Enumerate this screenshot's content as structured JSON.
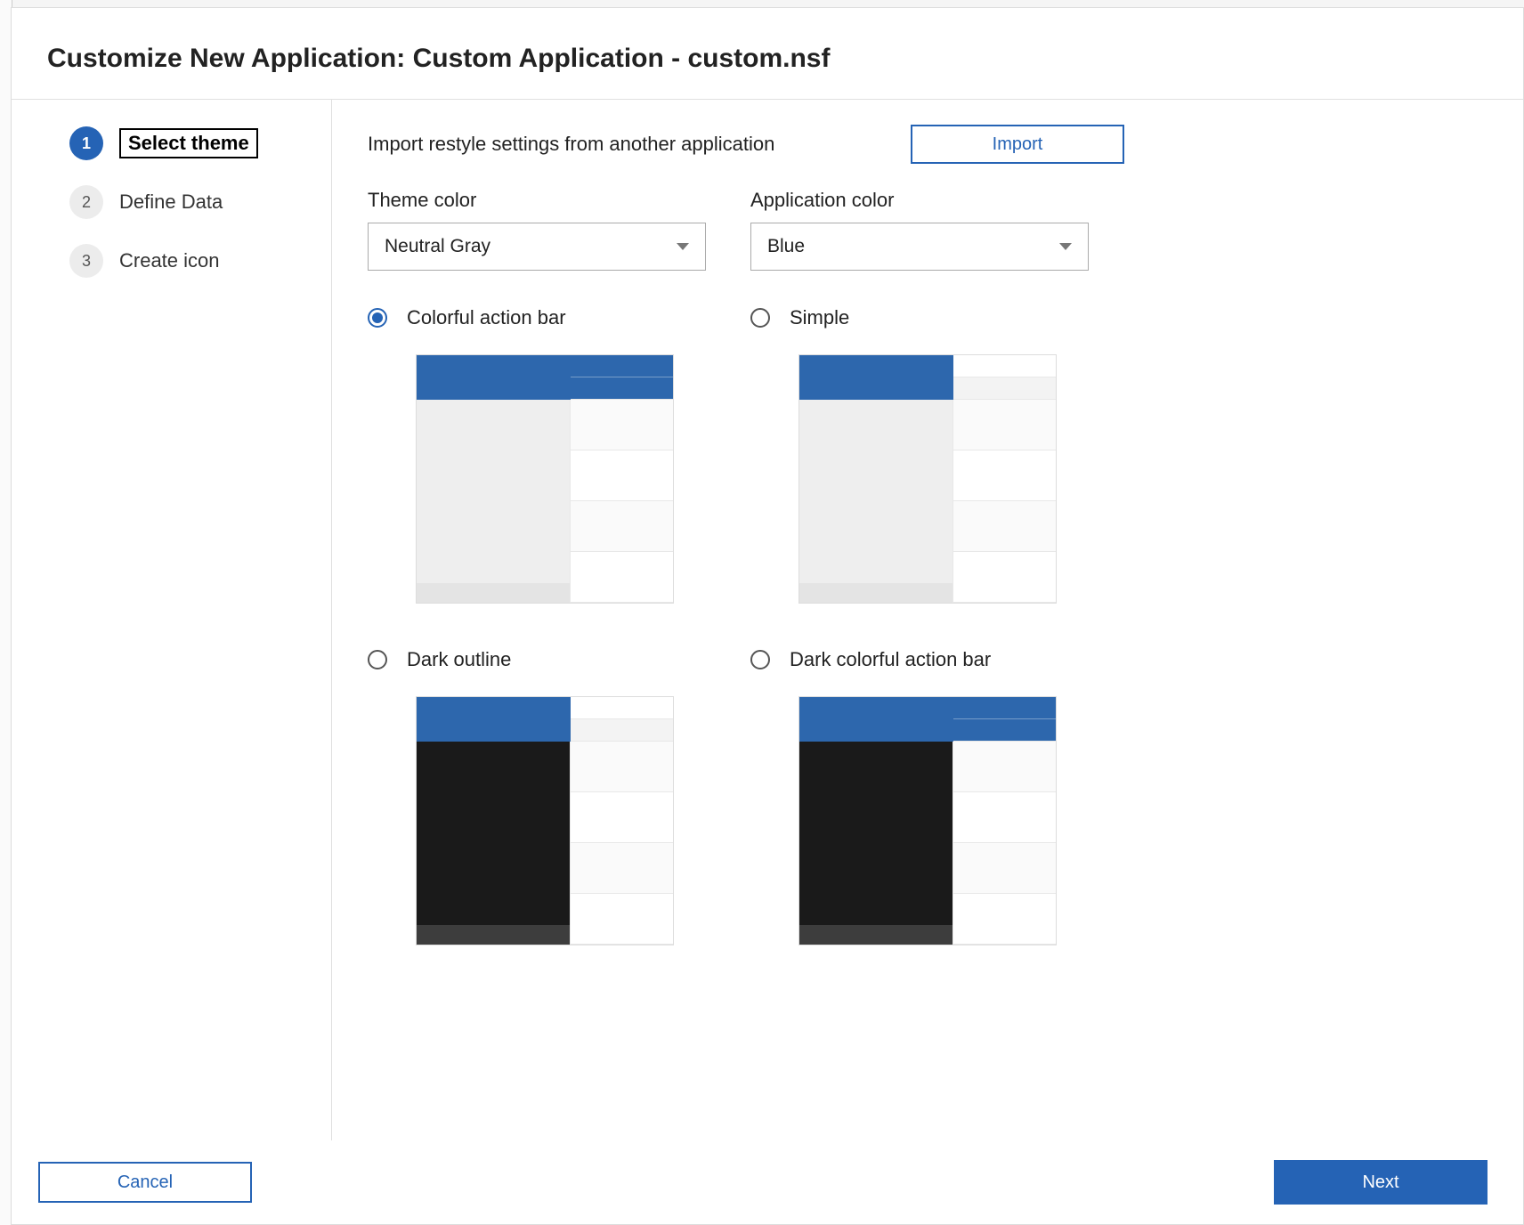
{
  "dialog": {
    "title": "Customize New Application: Custom Application - custom.nsf"
  },
  "steps": [
    {
      "num": "1",
      "label": "Select theme",
      "active": true
    },
    {
      "num": "2",
      "label": "Define Data",
      "active": false
    },
    {
      "num": "3",
      "label": "Create icon",
      "active": false
    }
  ],
  "import": {
    "label": "Import restyle settings from another application",
    "button": "Import"
  },
  "theme_color": {
    "label": "Theme color",
    "value": "Neutral Gray"
  },
  "app_color": {
    "label": "Application color",
    "value": "Blue"
  },
  "theme_options": [
    {
      "id": "colorful",
      "label": "Colorful action bar",
      "selected": true,
      "dark_body": false,
      "color_top_right": true
    },
    {
      "id": "simple",
      "label": "Simple",
      "selected": false,
      "dark_body": false,
      "color_top_right": false
    },
    {
      "id": "darkoutline",
      "label": "Dark outline",
      "selected": false,
      "dark_body": true,
      "color_top_right": false
    },
    {
      "id": "darkcolorful",
      "label": "Dark colorful action bar",
      "selected": false,
      "dark_body": true,
      "color_top_right": true
    }
  ],
  "footer": {
    "cancel": "Cancel",
    "next": "Next"
  },
  "colors": {
    "accent": "#2d67ad",
    "light": "#eeeeee",
    "dark": "#1a1a1a",
    "dark_slim": "#3d3d3d",
    "light_slim": "#e4e4e4"
  }
}
